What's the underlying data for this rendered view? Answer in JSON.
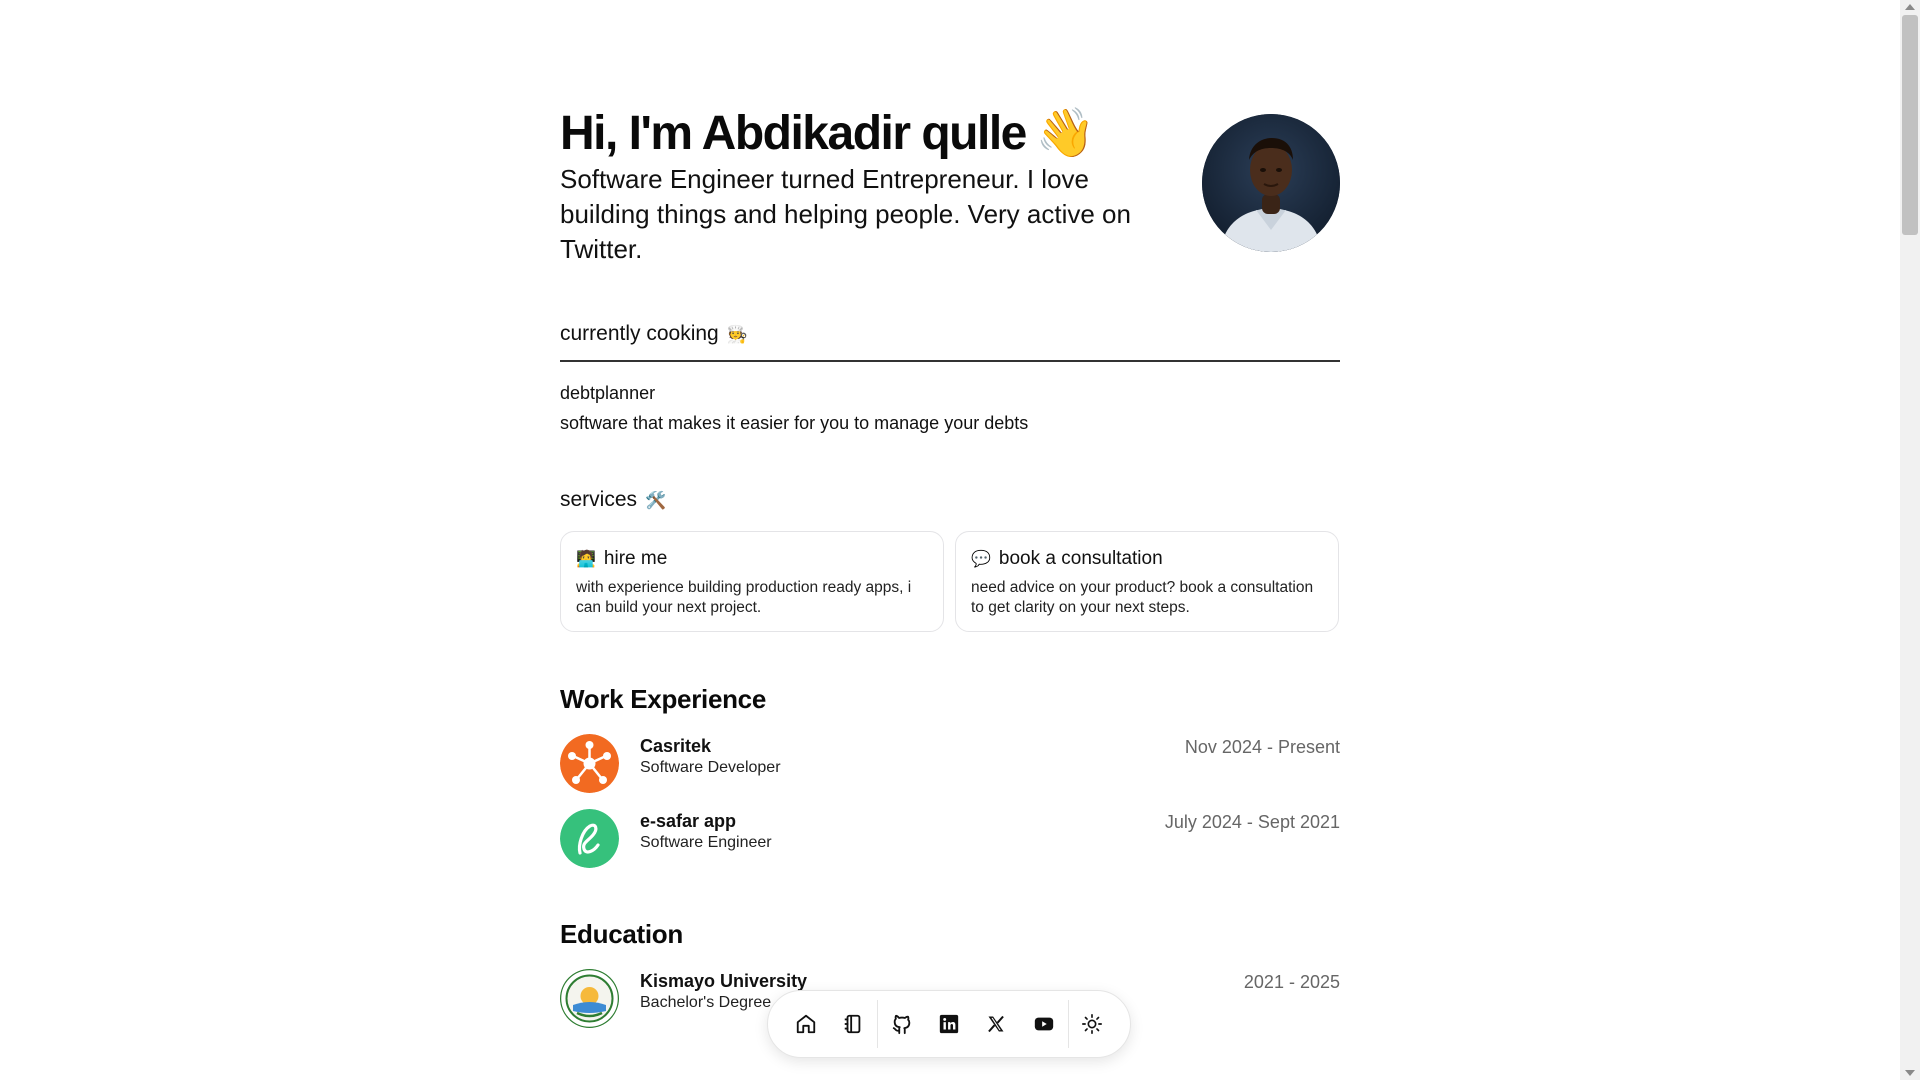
{
  "hero": {
    "title": "Hi, I'm Abdikadir qulle",
    "wave_emoji": "👋",
    "subtitle": "Software Engineer turned Entrepreneur. I love building things and helping people. Very active on Twitter."
  },
  "cooking": {
    "heading": "currently cooking",
    "emoji": "🧑‍🍳",
    "project_name": "debtplanner",
    "project_description": "software that makes it easier for you to manage your debts"
  },
  "services": {
    "heading": "services",
    "emoji": "🛠️",
    "cards": [
      {
        "icon": "🧑‍💻",
        "title": "hire me",
        "description": "with experience building production ready apps, i can build your next project."
      },
      {
        "icon": "💬",
        "title": "book a consultation",
        "description": "need advice on your product? book a consultation to get clarity on your next steps."
      }
    ]
  },
  "work": {
    "heading": "Work Experience",
    "items": [
      {
        "company": "Casritek",
        "role": "Software Developer",
        "dates": "Nov 2024 - Present",
        "logo_icon": "network-node-icon",
        "logo_color": "#f26a21"
      },
      {
        "company": "e-safar app",
        "role": "Software Engineer",
        "dates": "July 2024 - Sept 2021",
        "logo_icon": "script-letter-icon",
        "logo_color": "#36c17c"
      }
    ]
  },
  "education": {
    "heading": "Education",
    "items": [
      {
        "school": "Kismayo University",
        "degree": "Bachelor's Degree",
        "dates": "2021 - 2025",
        "logo_icon": "university-seal-icon"
      }
    ]
  },
  "dock": {
    "items": [
      "home-icon",
      "notebook-icon",
      "github-icon",
      "linkedin-icon",
      "x-icon",
      "youtube-icon",
      "sun-icon"
    ]
  }
}
